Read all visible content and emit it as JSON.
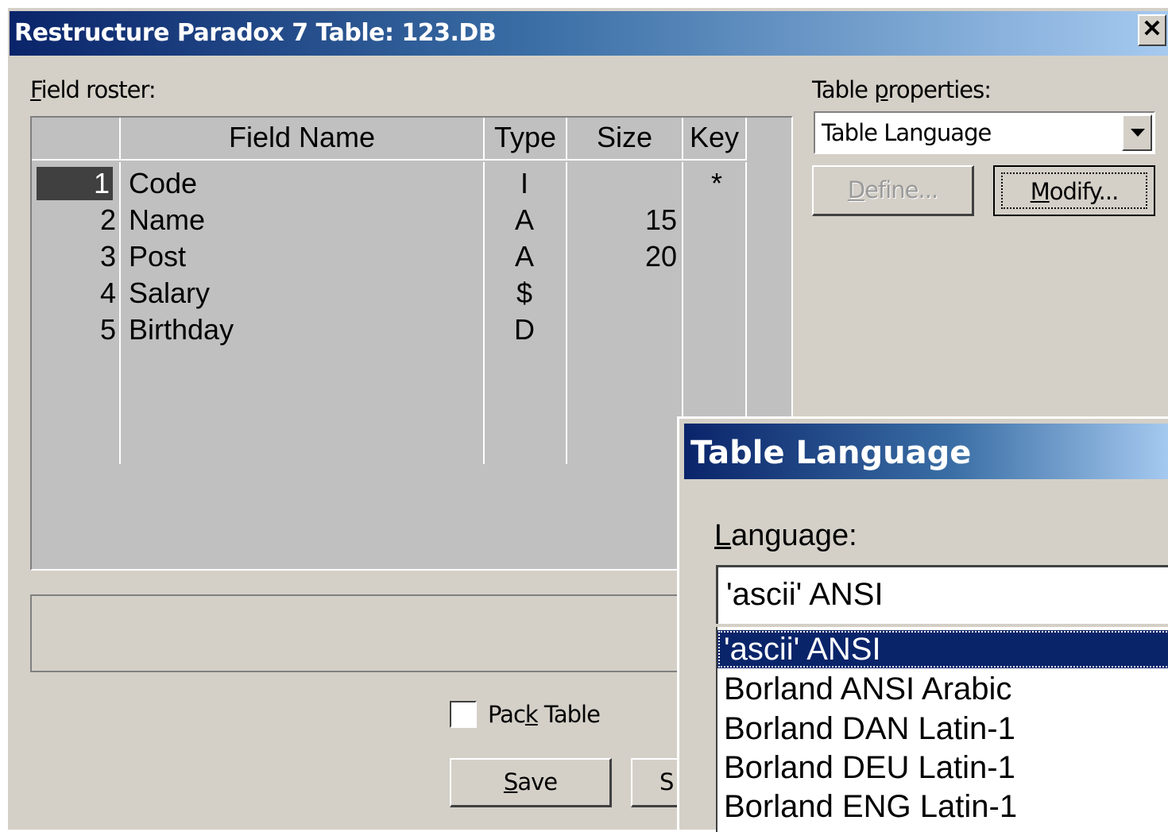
{
  "main_dialog": {
    "title": "Restructure Paradox 7 Table: 123.DB",
    "close_symbol": "✕",
    "field_roster_label_first": "F",
    "field_roster_label_rest": "ield roster:",
    "columns": {
      "num": "",
      "name": "Field Name",
      "type": "Type",
      "size": "Size",
      "key": "Key"
    },
    "fields": [
      {
        "num": "1",
        "name": "Code",
        "type": "I",
        "size": "",
        "key": "*"
      },
      {
        "num": "2",
        "name": "Name",
        "type": "A",
        "size": "15",
        "key": ""
      },
      {
        "num": "3",
        "name": "Post",
        "type": "A",
        "size": "20",
        "key": ""
      },
      {
        "num": "4",
        "name": "Salary",
        "type": "$",
        "size": "",
        "key": ""
      },
      {
        "num": "5",
        "name": "Birthday",
        "type": "D",
        "size": "",
        "key": ""
      }
    ],
    "table_properties_label_pre": "Table ",
    "table_properties_label_u": "p",
    "table_properties_label_post": "roperties:",
    "table_properties_value": "Table Language",
    "define_u": "D",
    "define_rest": "efine...",
    "modify_u": "M",
    "modify_rest": "odify...",
    "pack_table_pre": "Pac",
    "pack_table_u": "k",
    "pack_table_post": " Table",
    "save_u": "S",
    "save_rest": "ave",
    "save_as_partial": "S"
  },
  "language_dialog": {
    "title": "Table Language",
    "label_u": "L",
    "label_rest": "anguage:",
    "selected_value": "'ascii' ANSI",
    "options": [
      "'ascii' ANSI",
      "Borland ANSI Arabic",
      "Borland DAN Latin-1",
      "Borland DEU Latin-1",
      "Borland ENG Latin-1"
    ]
  }
}
